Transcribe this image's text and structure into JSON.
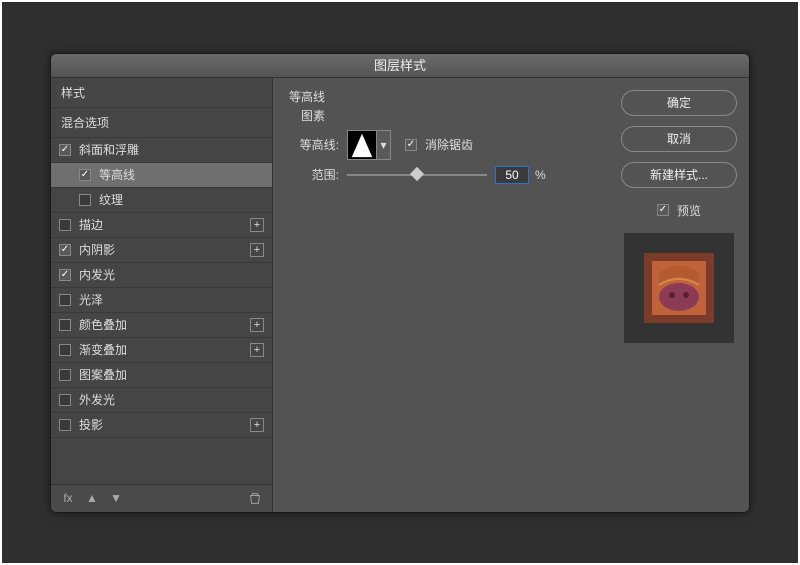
{
  "title": "图层样式",
  "sidebar": {
    "styleHead": "样式",
    "blendHead": "混合选项",
    "rows": [
      {
        "label": "斜面和浮雕",
        "checked": true,
        "plus": false
      },
      {
        "label": "等高线",
        "checked": true,
        "plus": false,
        "sub": true,
        "selected": true
      },
      {
        "label": "纹理",
        "checked": false,
        "plus": false,
        "sub": true
      },
      {
        "label": "描边",
        "checked": false,
        "plus": true
      },
      {
        "label": "内阴影",
        "checked": true,
        "plus": true
      },
      {
        "label": "内发光",
        "checked": true,
        "plus": false
      },
      {
        "label": "光泽",
        "checked": false,
        "plus": false
      },
      {
        "label": "颜色叠加",
        "checked": false,
        "plus": true
      },
      {
        "label": "渐变叠加",
        "checked": false,
        "plus": true
      },
      {
        "label": "图案叠加",
        "checked": false,
        "plus": false
      },
      {
        "label": "外发光",
        "checked": false,
        "plus": false
      },
      {
        "label": "投影",
        "checked": false,
        "plus": true
      }
    ]
  },
  "center": {
    "sectionLabel": "等高线",
    "elementsLabel": "图素",
    "contourLabel": "等高线:",
    "antiAlias": "消除锯齿",
    "rangeLabel": "范围:",
    "rangeValue": "50",
    "rangePercent": "%",
    "rangePos": 50
  },
  "right": {
    "ok": "确定",
    "cancel": "取消",
    "newStyle": "新建样式...",
    "preview": "预览"
  }
}
